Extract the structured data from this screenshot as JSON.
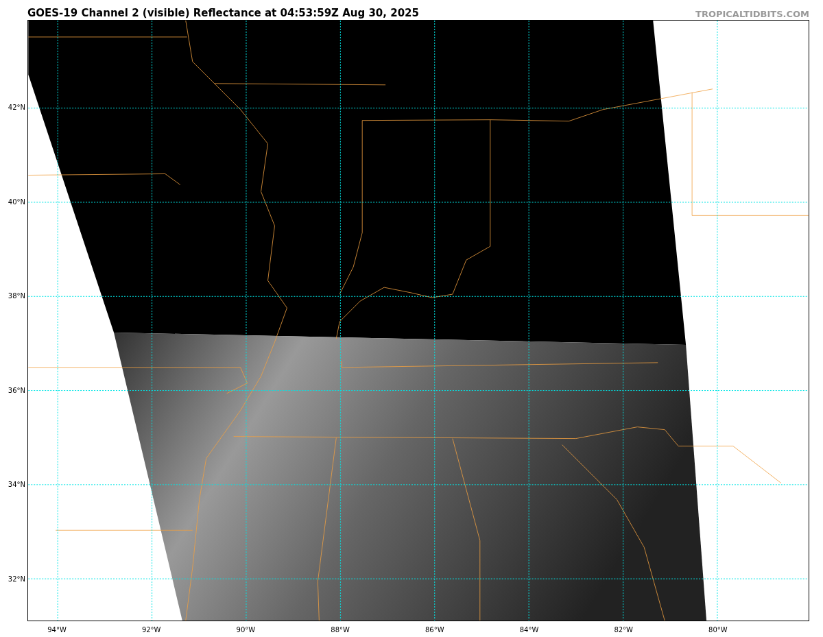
{
  "title": "GOES-19 Channel 2 (visible) Reflectance at 04:53:59Z Aug 30, 2025",
  "credit": "TROPICALTIDBITS.COM",
  "map": {
    "lat_labels": [
      "42°N",
      "40°N",
      "38°N",
      "36°N",
      "34°N",
      "32°N"
    ],
    "lon_labels": [
      "94°W",
      "92°W",
      "90°W",
      "88°W",
      "86°W",
      "84°W",
      "82°W",
      "80°W"
    ]
  }
}
